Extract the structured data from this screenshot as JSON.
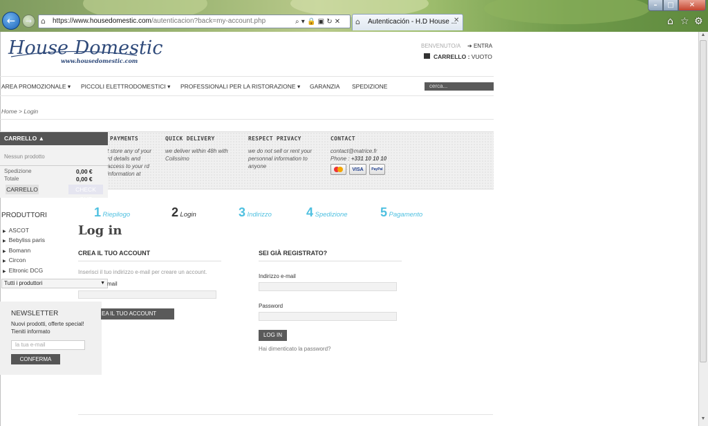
{
  "browser": {
    "url_prefix": "https://www.",
    "url_domain": "housedomestic.com",
    "url_rest": "/autenticacion?back=my-account.php",
    "address_icons": "⌕ ▾ 🔒 ▣ ↻ ✕",
    "tab_title": "Autenticación - H.D House ...",
    "tab_close": "✕",
    "back_glyph": "←",
    "fwd_glyph": "→",
    "min_glyph": "–",
    "max_glyph": "□",
    "close_glyph": "✕",
    "home_glyph": "⌂",
    "star_glyph": "☆",
    "gear_glyph": "⚙"
  },
  "header": {
    "logo_title": "House Domestic",
    "logo_subtitle": "www.housedomestic.com",
    "welcome": "BENVENUTO/A",
    "login_arrow": "➔",
    "login": "ENTRA",
    "cart_label": "CARRELLO :",
    "cart_value": "VUOTO"
  },
  "menu": {
    "items": [
      "AREA PROMOZIONALE ▾",
      "PICCOLI ELETTRODOMESTICI ▾",
      "PROFESSIONALI PER LA RISTORAZIONE ▾",
      "GARANZIA",
      "SPEDIZIONE"
    ],
    "search_placeholder": "cerca..."
  },
  "breadcrumb": "Home > Login",
  "info": {
    "payments_h": "PAYMENTS",
    "payments_t": "t store any of your rd details and access to your rd information at",
    "delivery_h": "QUICK DELIVERY",
    "delivery_t": "we deliver within 48h with Colissimo",
    "privacy_h": "RESPECT PRIVACY",
    "privacy_t": "we do not sell or rent your personnal information to anyone",
    "contact_h": "CONTACT",
    "contact_email": "contact@matrice.fr",
    "contact_phone_lbl": "Phone : ",
    "contact_phone": "+331 10 10 10",
    "card_visa": "VISA",
    "card_paypal": "PayPal"
  },
  "cart": {
    "title": "CARRELLO ▲",
    "empty": "Nessun prodotto",
    "shipping_lbl": "Spedizione",
    "shipping_val": "0,00 €",
    "total_lbl": "Totale",
    "total_val": "0,00 €",
    "cart_btn": "CARRELLO",
    "checkout_btn": "CHECK OUT"
  },
  "producers": {
    "title": "PRODUTTORI",
    "items": [
      "ASCOT",
      "Bebyliss paris",
      "Bomann",
      "Circon",
      "Eltronic DCG"
    ],
    "select": "Tutti i produttori"
  },
  "newsletter": {
    "title": "NEWSLETTER",
    "text": "Nuovi prodotti, offerte special! Tieniti informato",
    "placeholder": "la tua e-mail",
    "button": "CONFERMA"
  },
  "steps": [
    {
      "num": "1",
      "label": "Riepilogo"
    },
    {
      "num": "2",
      "label": "Login"
    },
    {
      "num": "3",
      "label": "Indirizzo"
    },
    {
      "num": "4",
      "label": "Spedizione"
    },
    {
      "num": "5",
      "label": "Pagamento"
    }
  ],
  "login": {
    "title": "Log in",
    "create_h": "CREA IL TUO ACCOUNT",
    "create_desc": "Inserisci il tuo indirizzo e-mail per creare un account.",
    "create_email_lbl": "mail",
    "create_btn": "EA IL TUO ACCOUNT",
    "registered_h": "SEI GIÀ REGISTRATO?",
    "email_lbl": "Indirizzo e-mail",
    "pwd_lbl": "Password",
    "login_btn": "LOG IN",
    "forgot": "Hai dimenticato la password?"
  },
  "colors": {
    "accent_steps": "#4ec0e0",
    "dark_button": "#5a5a5a",
    "logo": "#2f4a7a"
  }
}
